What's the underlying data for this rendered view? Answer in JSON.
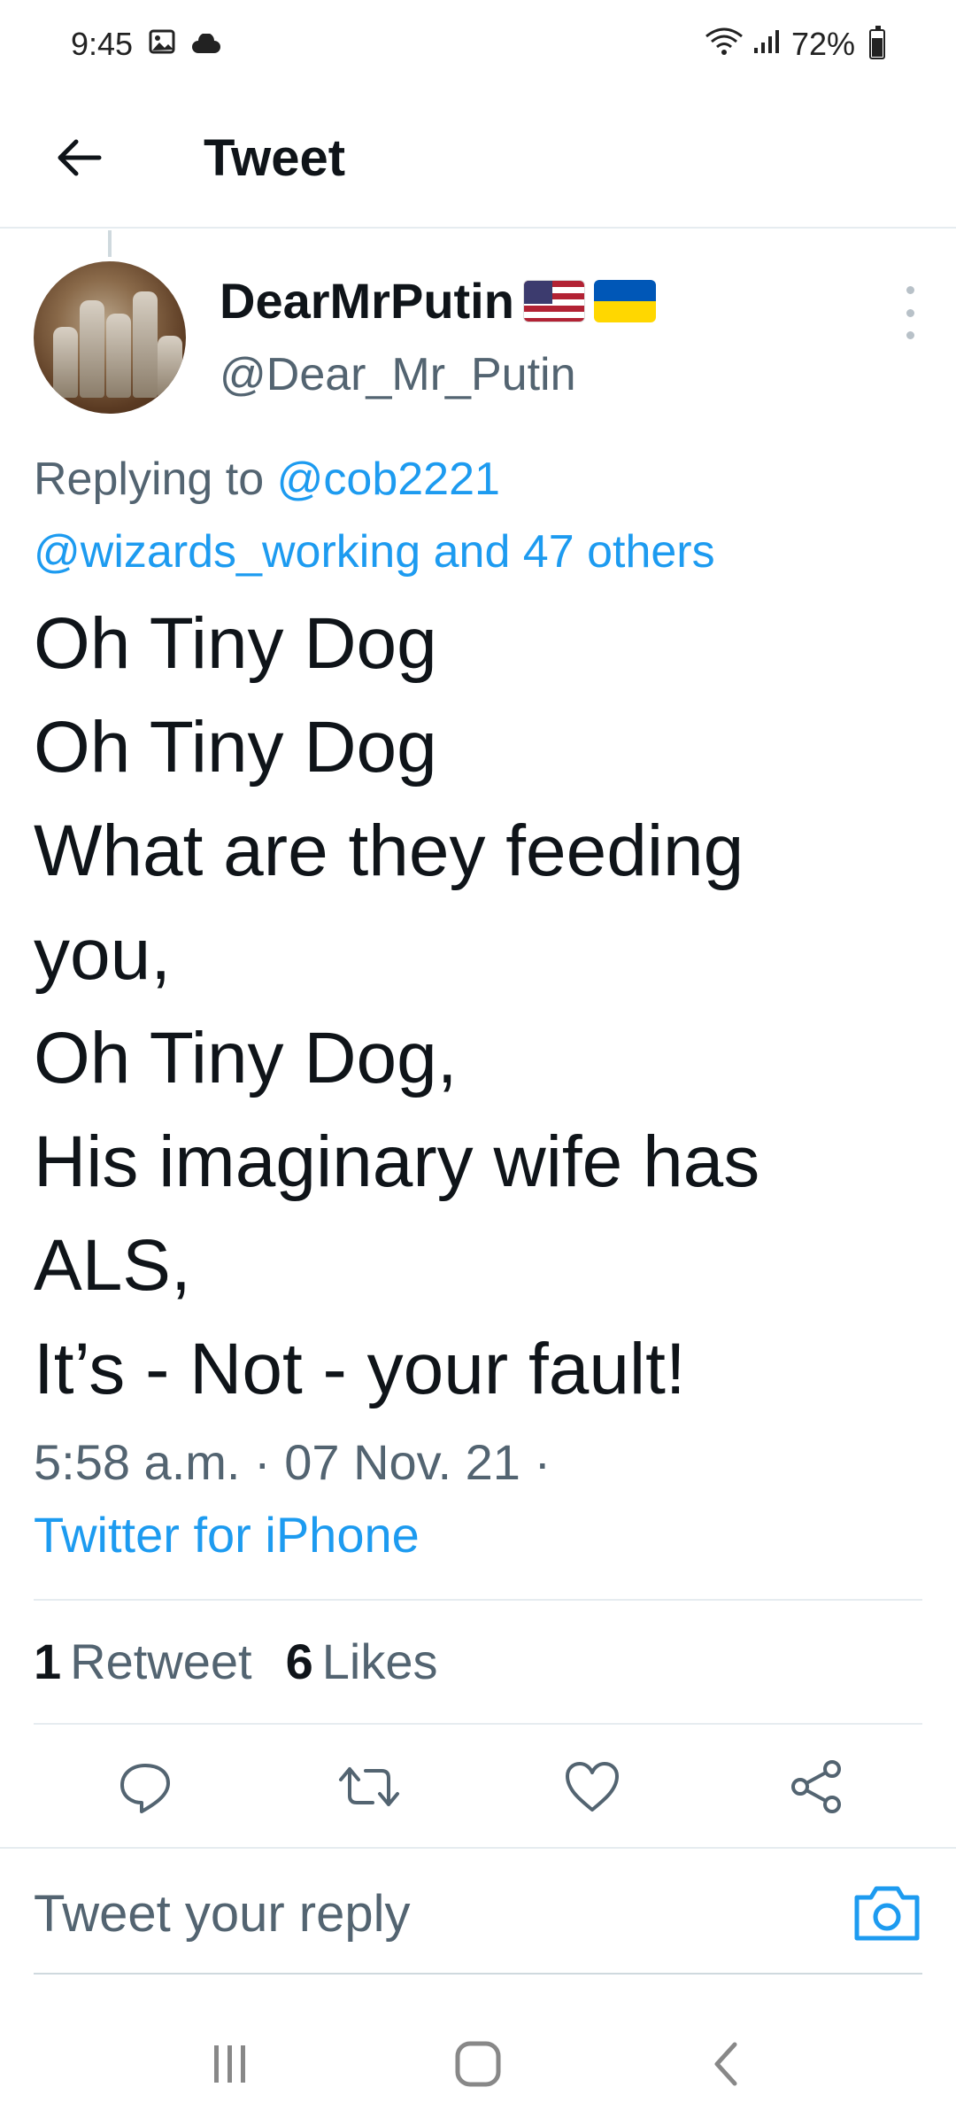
{
  "status_bar": {
    "time": "9:45",
    "battery": "72%",
    "icons": [
      "image-icon",
      "cloud-icon",
      "wifi-icon",
      "signal-icon",
      "battery-icon"
    ]
  },
  "app_bar": {
    "title": "Tweet",
    "back_icon": "arrow-left-icon"
  },
  "tweet": {
    "display_name": "DearMrPutin",
    "handle": "@Dear_Mr_Putin",
    "flags": [
      "us-flag-icon",
      "ukraine-flag-icon"
    ],
    "replying_prefix": "Replying to ",
    "replying_to_user": "@cob2221",
    "replying_line2": "@wizards_working and 47 others",
    "body_lines": [
      "Oh Tiny Dog",
      "Oh Tiny Dog",
      "What are they feeding",
      "you,",
      "Oh Tiny Dog,",
      "His imaginary wife has",
      "ALS,",
      "It’s - Not - your fault!"
    ],
    "timestamp": "5:58 a.m. · 07 Nov. 21 ·",
    "source": "Twitter for iPhone",
    "retweets_count": "1",
    "retweets_label": "Retweet",
    "likes_count": "6",
    "likes_label": "Likes"
  },
  "actions": [
    "reply-icon",
    "retweet-icon",
    "like-icon",
    "share-icon"
  ],
  "reply_bar": {
    "placeholder": "Tweet your reply",
    "camera_icon": "camera-icon"
  },
  "nav_bar": [
    "recents-icon",
    "home-icon",
    "back-icon"
  ],
  "colors": {
    "accent": "#1d9bf0",
    "text_primary": "#0f1419",
    "text_secondary": "#536471",
    "divider": "#e6ecf0"
  }
}
